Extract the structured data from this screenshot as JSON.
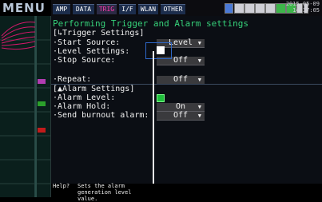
{
  "menu_label": "MENU",
  "tabs": [
    {
      "label": "AMP",
      "active": false
    },
    {
      "label": "DATA",
      "active": false
    },
    {
      "label": "TRIG",
      "active": true
    },
    {
      "label": "I/F",
      "active": false
    },
    {
      "label": "WLAN",
      "active": false
    },
    {
      "label": "OTHER",
      "active": false
    }
  ],
  "status_icons": [
    "usb-icon",
    "memory-icon",
    "memory-icon",
    "memory-icon",
    "memory-icon",
    "network-icon",
    "wlan-icon",
    "battery-icon",
    "signal-icon"
  ],
  "datetime": {
    "date": "2015-05-09",
    "time": "14:37:05"
  },
  "title": "Performing Trigger and Alarm settings",
  "trigger": {
    "header": "[↳Trigger Settings]",
    "start_source_label": "·Start Source:",
    "start_source_value": "Level",
    "level_settings_label": "·Level Settings:",
    "stop_source_label": "·Stop Source:",
    "stop_source_value": "Off",
    "repeat_label": "·Repeat:",
    "repeat_value": "Off"
  },
  "alarm": {
    "header": "[▲Alarm Settings]",
    "alarm_level_label": "·Alarm Level:",
    "alarm_hold_label": "·Alarm Hold:",
    "alarm_hold_value": "On",
    "burnout_label": "·Send burnout alarm:",
    "burnout_value": "Off"
  },
  "help": {
    "prefix": "Help?",
    "text": "Sets the alarm generation level value."
  },
  "colors": {
    "title": "#36d27a",
    "active_tab": "#ff3ab1",
    "trace": "#d4186a",
    "alarm_level": "#1fbf3c"
  }
}
